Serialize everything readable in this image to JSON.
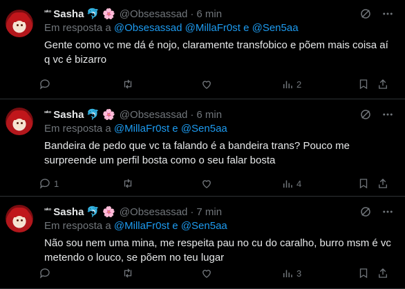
{
  "tweets": [
    {
      "name_prefix": "ˢᶦᵏᵒ",
      "name": "Sasha",
      "emoji1": "🐬",
      "emoji2": "🌸",
      "handle": "@Obsesassad",
      "separator": "·",
      "time": "6 min",
      "reply_label": "Em resposta a",
      "mentions": [
        "@Obsesassad",
        "@MillaFr0st",
        "@Sen5aa"
      ],
      "joiner": "e",
      "text": "Gente como vc me dá é nojo, claramente transfobico e põem mais coisa aí q vc é bizarro",
      "replies": "",
      "views": "2"
    },
    {
      "name_prefix": "ˢᶦᵏᵒ",
      "name": "Sasha",
      "emoji1": "🐬",
      "emoji2": "🌸",
      "handle": "@Obsesassad",
      "separator": "·",
      "time": "6 min",
      "reply_label": "Em resposta a",
      "mentions": [
        "@MillaFr0st",
        "@Sen5aa"
      ],
      "joiner": "e",
      "text": "Bandeira de pedo que vc ta falando é a bandeira trans? Pouco me surpreende um perfil bosta como o seu falar bosta",
      "replies": "1",
      "views": "4"
    },
    {
      "name_prefix": "ˢᶦᵏᵒ",
      "name": "Sasha",
      "emoji1": "🐬",
      "emoji2": "🌸",
      "handle": "@Obsesassad",
      "separator": "·",
      "time": "7 min",
      "reply_label": "Em resposta a",
      "mentions": [
        "@MillaFr0st",
        "@Sen5aa"
      ],
      "joiner": "e",
      "text": "Não sou nem uma mina, me respeita pau no cu do caralho, burro msm é vc metendo o louco, se põem no teu lugar",
      "replies": "",
      "views": "3"
    }
  ],
  "icons": {
    "reply": "comment-icon",
    "retweet": "retweet-icon",
    "like": "heart-icon",
    "views": "analytics-icon",
    "bookmark": "bookmark-icon",
    "share": "share-icon",
    "grok": "grok-icon",
    "more": "more-icon"
  },
  "colors": {
    "background": "#000000",
    "text": "#e7e9ea",
    "muted": "#71767b",
    "link": "#1d9bf0",
    "border": "#2f3336"
  }
}
